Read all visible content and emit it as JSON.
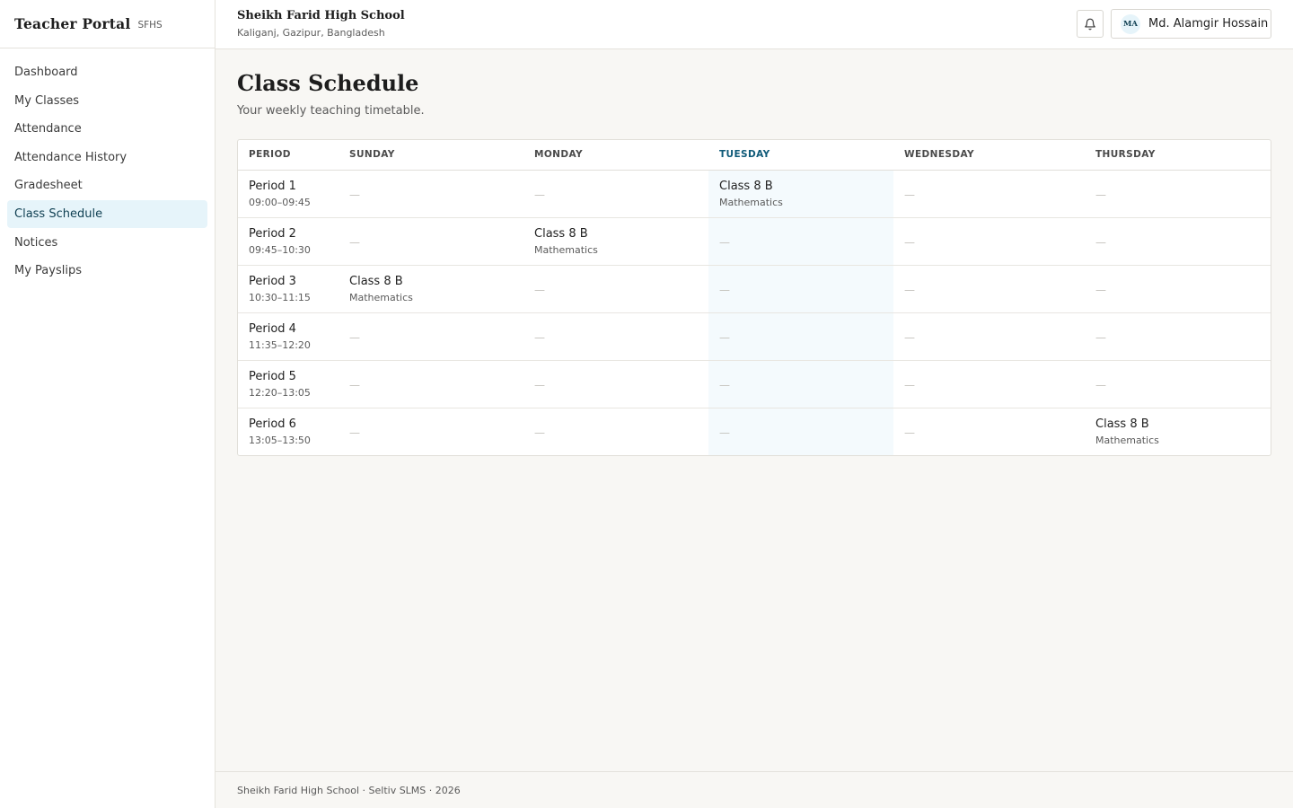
{
  "brand": {
    "title": "Teacher Portal",
    "tag": "SFHS"
  },
  "nav": {
    "items": [
      {
        "label": "Dashboard",
        "active": false
      },
      {
        "label": "My Classes",
        "active": false
      },
      {
        "label": "Attendance",
        "active": false
      },
      {
        "label": "Attendance History",
        "active": false
      },
      {
        "label": "Gradesheet",
        "active": false
      },
      {
        "label": "Class Schedule",
        "active": true
      },
      {
        "label": "Notices",
        "active": false
      },
      {
        "label": "My Payslips",
        "active": false
      }
    ]
  },
  "header": {
    "school_name": "Sheikh Farid High School",
    "location": "Kaliganj, Gazipur, Bangladesh",
    "bell_icon": "bell-icon",
    "user": {
      "initials": "MA",
      "name": "Md. Alamgir Hossain"
    }
  },
  "page": {
    "title": "Class Schedule",
    "subtitle": "Your weekly teaching timetable."
  },
  "schedule": {
    "columns": [
      "PERIOD",
      "SUNDAY",
      "MONDAY",
      "TUESDAY",
      "WEDNESDAY",
      "THURSDAY"
    ],
    "today_index": 3,
    "empty_mark": "—",
    "rows": [
      {
        "period": "Period 1",
        "time": "09:00–09:45",
        "cells": [
          null,
          null,
          {
            "class": "Class 8 B",
            "subject": "Mathematics"
          },
          null,
          null
        ]
      },
      {
        "period": "Period 2",
        "time": "09:45–10:30",
        "cells": [
          null,
          {
            "class": "Class 8 B",
            "subject": "Mathematics"
          },
          null,
          null,
          null
        ]
      },
      {
        "period": "Period 3",
        "time": "10:30–11:15",
        "cells": [
          {
            "class": "Class 8 B",
            "subject": "Mathematics"
          },
          null,
          null,
          null,
          null
        ]
      },
      {
        "period": "Period 4",
        "time": "11:35–12:20",
        "cells": [
          null,
          null,
          null,
          null,
          null
        ]
      },
      {
        "period": "Period 5",
        "time": "12:20–13:05",
        "cells": [
          null,
          null,
          null,
          null,
          null
        ]
      },
      {
        "period": "Period 6",
        "time": "13:05–13:50",
        "cells": [
          null,
          null,
          null,
          null,
          {
            "class": "Class 8 B",
            "subject": "Mathematics"
          }
        ]
      }
    ]
  },
  "footer": {
    "text": "Sheikh Farid High School · Seltiv SLMS · 2026"
  },
  "colors": {
    "accent": "#0f5a78",
    "active_nav_bg": "#e6f4fa",
    "today_col_bg": "#f4fafd"
  }
}
